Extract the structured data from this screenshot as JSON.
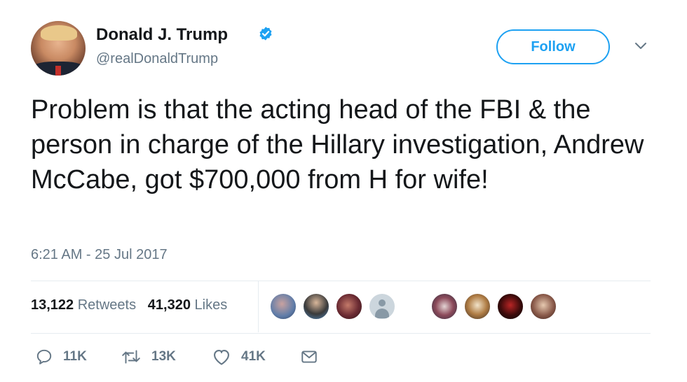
{
  "author": {
    "name": "Donald J. Trump",
    "handle": "@realDonaldTrump",
    "verified": true
  },
  "follow_label": "Follow",
  "tweet": {
    "text": "Problem is that the acting head of the FBI & the person in charge of the Hillary investigation, Andrew McCabe, got $700,000 from H for wife!",
    "timestamp": "6:21 AM - 25 Jul 2017"
  },
  "stats": {
    "retweets_count": "13,122",
    "retweets_label": "Retweets",
    "likes_count": "41,320",
    "likes_label": "Likes"
  },
  "actions": {
    "reply_count": "11K",
    "retweet_count": "13K",
    "like_count": "41K"
  },
  "colors": {
    "accent": "#1da1f2",
    "text": "#14171a",
    "muted": "#657786",
    "divider": "#e6ecf0"
  }
}
